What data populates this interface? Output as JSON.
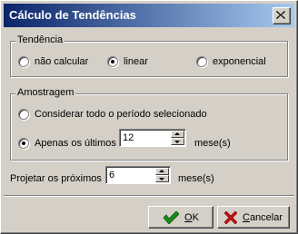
{
  "window": {
    "title": "Cálculo de Tendências"
  },
  "trend_group": {
    "title": "Tendência",
    "options": [
      {
        "label": "não calcular",
        "checked": false
      },
      {
        "label": "linear",
        "checked": true
      },
      {
        "label": "exponencial",
        "checked": false
      }
    ]
  },
  "sample_group": {
    "title": "Amostragem",
    "option_all": {
      "label": "Considerar todo o período selecionado",
      "checked": false
    },
    "option_last": {
      "label": "Apenas os últimos",
      "checked": true
    },
    "months_value": "12",
    "months_unit": "mese(s)"
  },
  "projection": {
    "label": "Projetar os próximos",
    "value": "6",
    "unit": "mese(s)"
  },
  "buttons": {
    "ok": "OK",
    "cancel": "Cancelar"
  }
}
